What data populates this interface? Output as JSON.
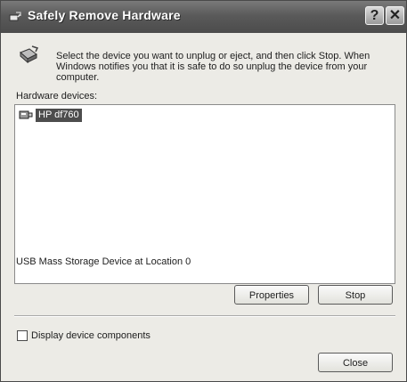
{
  "window": {
    "title": "Safely Remove Hardware",
    "help_glyph": "?",
    "close_glyph": "✕"
  },
  "dialog": {
    "instructions": "Select the device you want to unplug or eject, and then click Stop. When Windows notifies you that it is safe to do so unplug the device from your computer.",
    "hardware_label": "Hardware devices:",
    "devices": [
      {
        "label": "HP df760",
        "icon": "usb-device-icon",
        "selected": true
      }
    ],
    "status_text": "USB Mass Storage Device at Location 0",
    "properties_label": "Properties",
    "stop_label": "Stop",
    "checkbox_label": "Display device components",
    "checkbox_checked": false,
    "close_label": "Close"
  },
  "icons": {
    "title": "eject-hardware-icon",
    "dialog": "eject-hardware-icon",
    "device": "usb-device-icon"
  },
  "colors": {
    "titlebar": "#5a5a5a",
    "selection": "#4d4d4d",
    "dialog_bg": "#ecebe6"
  }
}
